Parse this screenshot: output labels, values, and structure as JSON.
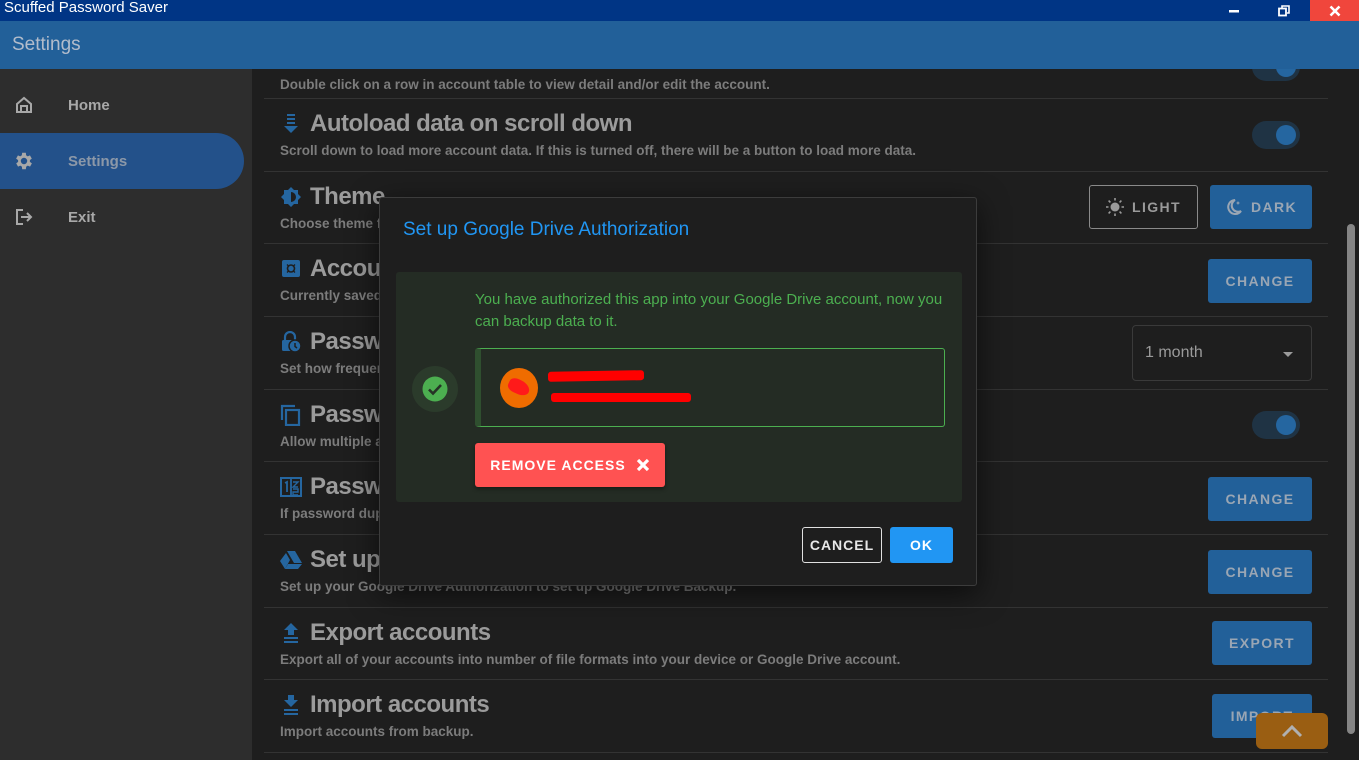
{
  "window": {
    "title": "Scuffed Password Saver",
    "minimize_icon": "minimize-icon",
    "restore_icon": "restore-icon",
    "close_icon": "close-icon"
  },
  "appbar": {
    "title": "Settings"
  },
  "sidebar": {
    "items": [
      {
        "label": "Home",
        "icon": "home-icon",
        "active": false
      },
      {
        "label": "Settings",
        "icon": "gear-icon",
        "active": true
      },
      {
        "label": "Exit",
        "icon": "exit-icon",
        "active": false
      }
    ]
  },
  "settings": {
    "rows": [
      {
        "key": "double-click",
        "title": "",
        "description": "Double click on a row in account table to view detail and/or edit the account.",
        "control": "toggle",
        "value": true
      },
      {
        "key": "autoload",
        "title": "Autoload data on scroll down",
        "icon": "autoload-icon",
        "description": "Scroll down to load more account data. If this is turned off, there will be a button to load more data.",
        "control": "toggle",
        "value": true
      },
      {
        "key": "theme",
        "title": "Theme",
        "icon": "theme-icon",
        "description": "Choose theme f",
        "control": "buttons",
        "buttons": [
          "LIGHT",
          "DARK"
        ],
        "selected": "DARK"
      },
      {
        "key": "account-file",
        "title": "Accou",
        "icon": "safe-icon",
        "description": "Currently saved",
        "control": "button",
        "button": "CHANGE"
      },
      {
        "key": "password-expiry",
        "title": "Passw",
        "icon": "lock-clock-icon",
        "description": "Set how frequen",
        "control": "select",
        "value": "1 month"
      },
      {
        "key": "password-duplicate",
        "title": "Passw",
        "icon": "copy-icon",
        "description": "Allow multiple a",
        "control": "toggle",
        "value": true
      },
      {
        "key": "password-generator",
        "title": "Passw",
        "icon": "numbers-icon",
        "description": "If password dup",
        "control": "button",
        "button": "CHANGE"
      },
      {
        "key": "google-drive",
        "title": "Set up",
        "icon": "google-drive-icon",
        "description": "Set up your Google Drive Authorization to set up Google Drive Backup.",
        "control": "button",
        "button": "CHANGE"
      },
      {
        "key": "export",
        "title": "Export accounts",
        "icon": "export-icon",
        "description": "Export all of your accounts into number of file formats into your device or Google Drive account.",
        "control": "button",
        "button": "EXPORT"
      },
      {
        "key": "import",
        "title": "Import accounts",
        "icon": "import-icon",
        "description": "Import accounts from backup.",
        "control": "button",
        "button": "IMPORT"
      }
    ]
  },
  "dialog": {
    "title": "Set up Google Drive Authorization",
    "message": "You have authorized this app into your Google Drive account, now you can backup data to it.",
    "account": {
      "name": "[redacted]",
      "email": "[redacted]"
    },
    "remove_label": "REMOVE ACCESS",
    "cancel_label": "CANCEL",
    "ok_label": "OK"
  },
  "colors": {
    "titlebar": "#003585",
    "appbar": "#226099",
    "accent": "#2196f3",
    "success": "#4caf50",
    "danger": "#ff5252",
    "scroll_top": "#9a5e12"
  }
}
